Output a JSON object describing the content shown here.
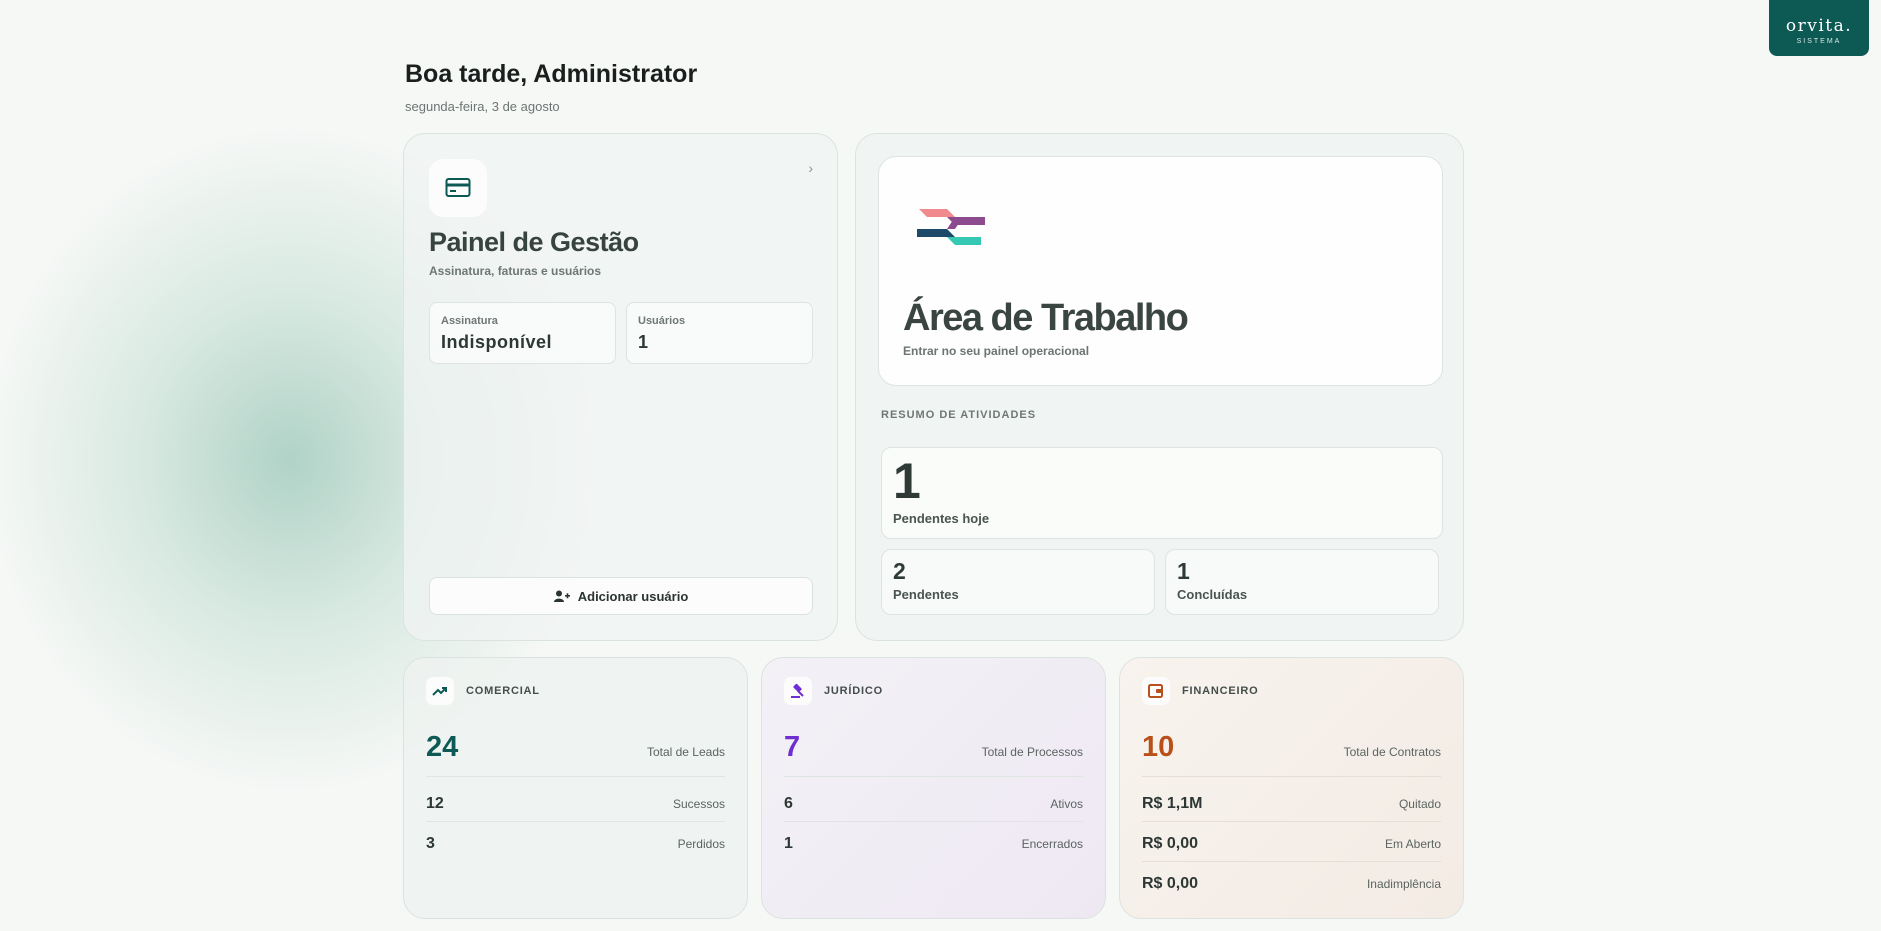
{
  "brand": {
    "name": "orvita.",
    "subtitle": "SISTEMA",
    "color": "#0d5a55"
  },
  "header": {
    "greeting": "Boa tarde, Administrator",
    "date": "segunda-feira, 3 de agosto"
  },
  "management": {
    "icon": "credit-card-icon",
    "title": "Painel de Gestão",
    "subtitle": "Assinatura, faturas e usuários",
    "subscription_label": "Assinatura",
    "subscription_value": "Indisponível",
    "users_label": "Usuários",
    "users_value": "1",
    "add_user_label": "Adicionar usuário"
  },
  "workspace": {
    "title": "Área de Trabalho",
    "subtitle": "Entrar no seu painel operacional",
    "summary_label": "RESUMO DE ATIVIDADES",
    "today_count": "1",
    "today_label": "Pendentes hoje",
    "pending_count": "2",
    "pending_label": "Pendentes",
    "done_count": "1",
    "done_label": "Concluídas"
  },
  "commercial": {
    "title": "COMERCIAL",
    "color": "#0d5a55",
    "total": "24",
    "total_label": "Total de Leads",
    "rows": [
      {
        "value": "12",
        "label": "Sucessos"
      },
      {
        "value": "3",
        "label": "Perdidos"
      }
    ]
  },
  "legal": {
    "title": "JURÍDICO",
    "color": "#6d2fd1",
    "total": "7",
    "total_label": "Total de Processos",
    "rows": [
      {
        "value": "6",
        "label": "Ativos"
      },
      {
        "value": "1",
        "label": "Encerrados"
      }
    ]
  },
  "financial": {
    "title": "FINANCEIRO",
    "color": "#b9501a",
    "total": "10",
    "total_label": "Total de Contratos",
    "rows": [
      {
        "value": "R$ 1,1M",
        "label": "Quitado"
      },
      {
        "value": "R$ 0,00",
        "label": "Em Aberto"
      },
      {
        "value": "R$ 0,00",
        "label": "Inadimplência"
      }
    ]
  }
}
